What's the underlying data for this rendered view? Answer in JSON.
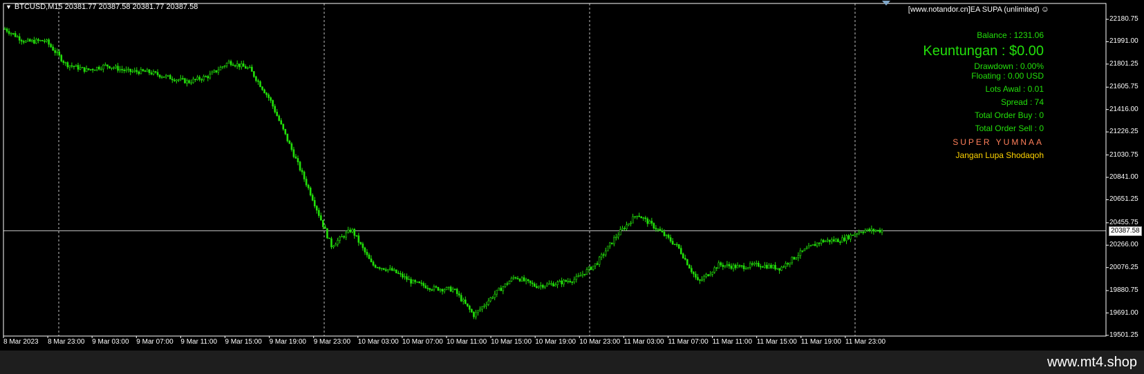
{
  "header": {
    "symbol_info": "BTCUSD,M15  20381.77 20387.58 20381.77 20387.58",
    "ea_title": "[www.notandor.cn]EA SUPA (unlimited)",
    "smiley_icon": "smiley-icon"
  },
  "panel": {
    "balance": "Balance : 1231.06",
    "profit": "Keuntungan : $0.00",
    "drawdown": "Drawdown  : 0.00%",
    "floating": "Floating : 0.00 USD",
    "lots": "Lots Awal : 0.01",
    "spread": "Spread : 74",
    "buy_orders": "Total Order Buy  :  0",
    "sell_orders": "Total Order Sell   :  0",
    "brand": "SUPER YUMNAA",
    "reminder": "Jangan Lupa Shodaqoh"
  },
  "price_axis": [
    "22180.75",
    "21991.00",
    "21801.25",
    "21605.75",
    "21416.00",
    "21226.25",
    "21030.75",
    "20841.00",
    "20651.25",
    "20455.75",
    "20266.00",
    "20076.25",
    "19880.75",
    "19691.00",
    "19501.25"
  ],
  "current_price": "20387.58",
  "time_axis": [
    "8 Mar 2023",
    "8 Mar 23:00",
    "9 Mar 03:00",
    "9 Mar 07:00",
    "9 Mar 11:00",
    "9 Mar 15:00",
    "9 Mar 19:00",
    "9 Mar 23:00",
    "10 Mar 03:00",
    "10 Mar 07:00",
    "10 Mar 11:00",
    "10 Mar 15:00",
    "10 Mar 19:00",
    "10 Mar 23:00",
    "11 Mar 03:00",
    "11 Mar 07:00",
    "11 Mar 11:00",
    "11 Mar 15:00",
    "11 Mar 19:00",
    "11 Mar 23:00"
  ],
  "watermark": "www.mt4.shop",
  "colors": {
    "background": "#000000",
    "candle": "#23e00b",
    "brand": "#ff7f5a",
    "reminder": "#ffd400",
    "grid": "#c0c0c0"
  },
  "chart_data": {
    "type": "line",
    "title": "",
    "xlabel": "",
    "ylabel": "",
    "ylim": [
      19501.25,
      22180.75
    ],
    "x": [
      "8 Mar 2023",
      "8 Mar 21:00",
      "8 Mar 23:00",
      "9 Mar 01:00",
      "9 Mar 03:00",
      "9 Mar 05:00",
      "9 Mar 07:00",
      "9 Mar 09:00",
      "9 Mar 11:00",
      "9 Mar 13:00",
      "9 Mar 15:00",
      "9 Mar 16:00",
      "9 Mar 17:00",
      "9 Mar 19:00",
      "9 Mar 20:00",
      "9 Mar 21:00",
      "9 Mar 22:00",
      "9 Mar 23:00",
      "10 Mar 01:00",
      "10 Mar 03:00",
      "10 Mar 05:00",
      "10 Mar 07:00",
      "10 Mar 09:00",
      "10 Mar 11:00",
      "10 Mar 13:00",
      "10 Mar 15:00",
      "10 Mar 17:00",
      "10 Mar 19:00",
      "10 Mar 21:00",
      "10 Mar 23:00",
      "11 Mar 01:00",
      "11 Mar 03:00",
      "11 Mar 05:00",
      "11 Mar 07:00",
      "11 Mar 08:00",
      "11 Mar 09:00",
      "11 Mar 11:00",
      "11 Mar 13:00",
      "11 Mar 15:00",
      "11 Mar 17:00",
      "11 Mar 19:00",
      "11 Mar 21:00",
      "11 Mar 23:00",
      "12 Mar 00:30"
    ],
    "series": [
      {
        "values": [
          22100,
          21990,
          22000,
          21800,
          21750,
          21790,
          21740,
          21735,
          21690,
          21650,
          21700,
          21820,
          21760,
          21500,
          21100,
          20700,
          20260,
          20400,
          20100,
          20050,
          19950,
          19900,
          19890,
          19670,
          19850,
          20000,
          19920,
          19940,
          19980,
          20110,
          20350,
          20530,
          20400,
          20250,
          19950,
          20100,
          20080,
          20100,
          20070,
          20200,
          20300,
          20310,
          20390,
          20390
        ]
      }
    ]
  }
}
